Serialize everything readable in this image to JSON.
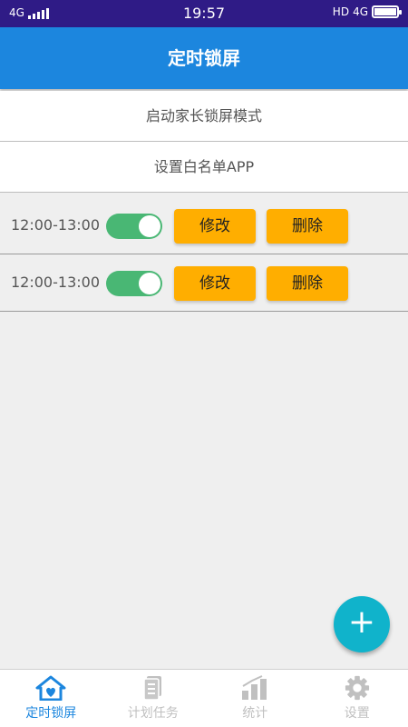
{
  "status": {
    "network_left": "4G",
    "time": "19:57",
    "hd": "HD",
    "network_right": "4G"
  },
  "header": {
    "title": "定时锁屏"
  },
  "menu": {
    "parent_lock_label": "启动家长锁屏模式",
    "whitelist_label": "设置白名单APP"
  },
  "schedules": [
    {
      "range": "12:00-13:00",
      "enabled": true,
      "edit_label": "修改",
      "delete_label": "删除"
    },
    {
      "range": "12:00-13:00",
      "enabled": true,
      "edit_label": "修改",
      "delete_label": "删除"
    }
  ],
  "fab": {
    "icon": "plus-icon",
    "label": "+"
  },
  "nav": {
    "items": [
      {
        "label": "定时锁屏",
        "icon": "home-heart-icon",
        "active": true
      },
      {
        "label": "计划任务",
        "icon": "document-icon",
        "active": false
      },
      {
        "label": "统计",
        "icon": "bar-chart-icon",
        "active": false
      },
      {
        "label": "设置",
        "icon": "gear-icon",
        "active": false
      }
    ]
  },
  "colors": {
    "status_bar": "#2f1b86",
    "header": "#1c86de",
    "button": "#ffae00",
    "toggle_on": "#49b774",
    "fab": "#10b3cb",
    "nav_active": "#1c86de",
    "nav_inactive": "#c0c0c0"
  }
}
